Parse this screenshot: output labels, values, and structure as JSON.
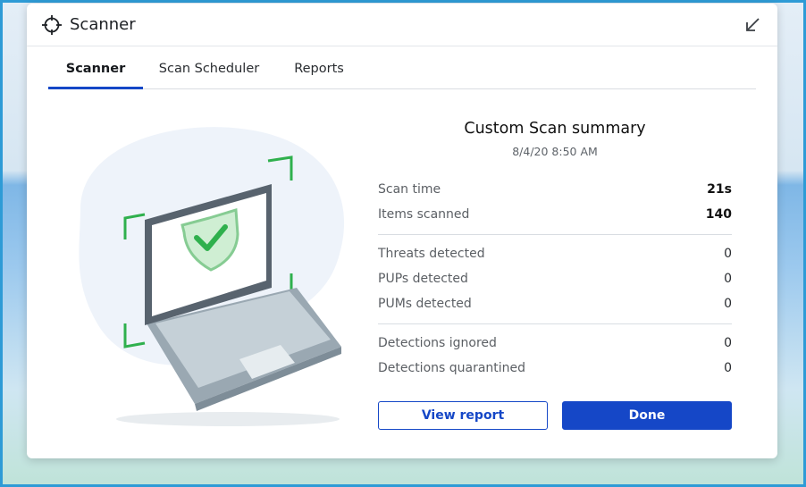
{
  "window": {
    "title": "Scanner",
    "app_icon": "crosshair-icon",
    "minimize_icon": "arrow-down-left-icon"
  },
  "tabs": [
    {
      "label": "Scanner",
      "active": true
    },
    {
      "label": "Scan Scheduler",
      "active": false
    },
    {
      "label": "Reports",
      "active": false
    }
  ],
  "illustration": {
    "icon": "laptop-shield-check-icon",
    "colors": {
      "accent_green": "#2fb04d",
      "laptop_frame": "#58636e",
      "laptop_body": "#9aa8b2"
    }
  },
  "summary": {
    "title": "Custom Scan summary",
    "date": "8/4/20 8:50 AM",
    "rows": [
      {
        "label": "Scan time",
        "value": "21s"
      },
      {
        "label": "Items scanned",
        "value": "140"
      },
      {
        "label": "Threats detected",
        "value": "0"
      },
      {
        "label": "PUPs detected",
        "value": "0"
      },
      {
        "label": "PUMs detected",
        "value": "0"
      },
      {
        "label": "Detections ignored",
        "value": "0"
      },
      {
        "label": "Detections quarantined",
        "value": "0"
      }
    ]
  },
  "buttons": {
    "view_report": "View report",
    "done": "Done"
  },
  "colors": {
    "brand_blue": "#1547c7"
  }
}
